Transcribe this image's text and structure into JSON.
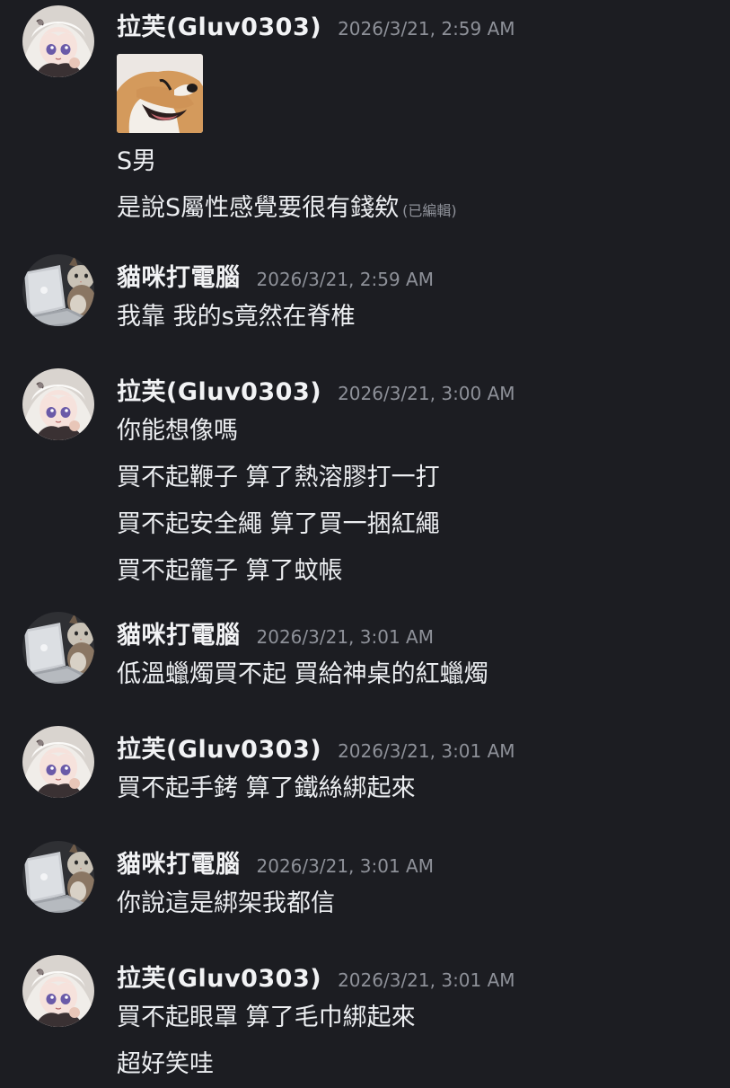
{
  "messages": [
    {
      "author": "拉芙(Gluv0303)",
      "timestamp": "2026/3/21, 2:59 AM",
      "avatar": "anime-girl-avatar",
      "attachment": "dog-sticker-image",
      "lines": [
        "S男",
        "是說S屬性感覺要很有錢欸"
      ],
      "edited_label": "(已編輯)"
    },
    {
      "author": "貓咪打電腦",
      "timestamp": "2026/3/21, 2:59 AM",
      "avatar": "cat-laptop-avatar",
      "lines": [
        "我靠 我的s竟然在脊椎"
      ]
    },
    {
      "author": "拉芙(Gluv0303)",
      "timestamp": "2026/3/21, 3:00 AM",
      "avatar": "anime-girl-avatar",
      "lines": [
        "你能想像嗎",
        "買不起鞭子 算了熱溶膠打一打",
        "買不起安全繩 算了買一捆紅繩",
        "買不起籠子 算了蚊帳"
      ]
    },
    {
      "author": "貓咪打電腦",
      "timestamp": "2026/3/21, 3:01 AM",
      "avatar": "cat-laptop-avatar",
      "lines": [
        "低溫蠟燭買不起 買給神桌的紅蠟燭"
      ]
    },
    {
      "author": "拉芙(Gluv0303)",
      "timestamp": "2026/3/21, 3:01 AM",
      "avatar": "anime-girl-avatar",
      "lines": [
        "買不起手銬 算了鐵絲綁起來"
      ]
    },
    {
      "author": "貓咪打電腦",
      "timestamp": "2026/3/21, 3:01 AM",
      "avatar": "cat-laptop-avatar",
      "lines": [
        "你說這是綁架我都信"
      ]
    },
    {
      "author": "拉芙(Gluv0303)",
      "timestamp": "2026/3/21, 3:01 AM",
      "avatar": "anime-girl-avatar",
      "lines": [
        "買不起眼罩 算了毛巾綁起來",
        "超好笑哇"
      ]
    }
  ],
  "colors": {
    "background": "#1c1d22",
    "text": "#eceef1",
    "timestamp": "#8e9199"
  }
}
